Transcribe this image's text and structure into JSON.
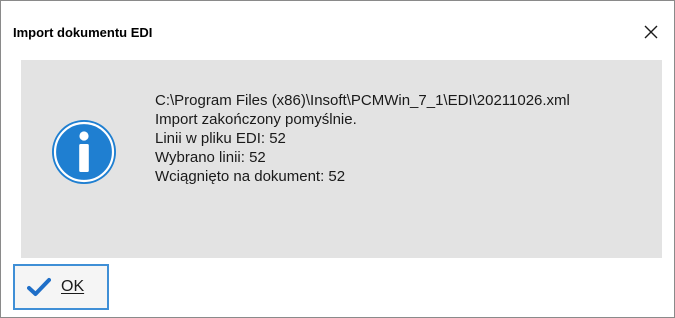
{
  "dialog": {
    "title": "Import dokumentu EDI",
    "close_icon": "close-icon"
  },
  "message": {
    "icon": "info-icon",
    "lines": [
      "C:\\Program Files (x86)\\Insoft\\PCMWin_7_1\\EDI\\20211026.xml",
      "Import zakończony pomyślnie.",
      "Linii w pliku EDI: 52",
      "Wybrano linii: 52",
      "Wciągnięto na dokument: 52"
    ]
  },
  "buttons": {
    "ok_label": "OK",
    "ok_icon": "checkmark-icon"
  },
  "colors": {
    "info_icon_blue": "#1f7fd1",
    "content_bg": "#e3e3e3",
    "button_border": "#3f8fd6",
    "check_blue": "#1f6fc8"
  }
}
